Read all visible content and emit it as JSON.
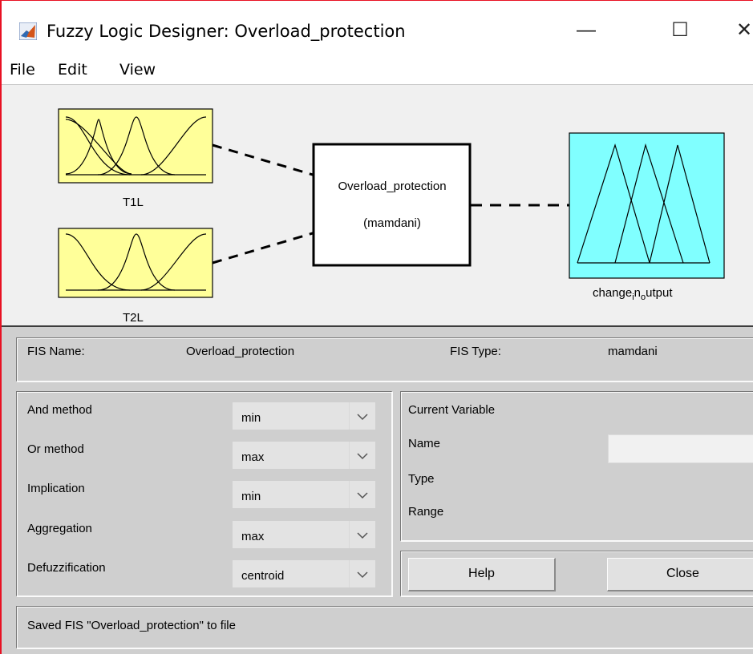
{
  "window": {
    "title": "Fuzzy Logic Designer: Overload_protection",
    "controls": {
      "minimize": "—",
      "maximize": "☐",
      "close": "✕"
    }
  },
  "menu": [
    "File",
    "Edit",
    "View"
  ],
  "diagram": {
    "inputs": [
      {
        "name": "T1L"
      },
      {
        "name": "T2L"
      }
    ],
    "system": {
      "name": "Overload_protection",
      "type": "(mamdani)"
    },
    "output": {
      "name_prefix": "change",
      "name_sub1": "i",
      "name_mid": "n",
      "name_sub2": "o",
      "name_suffix": "utput"
    },
    "colors": {
      "input_fill": "#ffff99",
      "output_fill": "#80ffff",
      "system_fill": "#ffffff"
    }
  },
  "fis_info": {
    "name_label": "FIS Name:",
    "name_value": "Overload_protection",
    "type_label": "FIS Type:",
    "type_value": "mamdani"
  },
  "methods": [
    {
      "label": "And method",
      "value": "min"
    },
    {
      "label": "Or method",
      "value": "max"
    },
    {
      "label": "Implication",
      "value": "min"
    },
    {
      "label": "Aggregation",
      "value": "max"
    },
    {
      "label": "Defuzzification",
      "value": "centroid"
    }
  ],
  "current_variable": {
    "title": "Current Variable",
    "name_label": "Name",
    "name_value": "",
    "type_label": "Type",
    "range_label": "Range"
  },
  "buttons": {
    "help": "Help",
    "close": "Close"
  },
  "status": "Saved FIS \"Overload_protection\" to file"
}
